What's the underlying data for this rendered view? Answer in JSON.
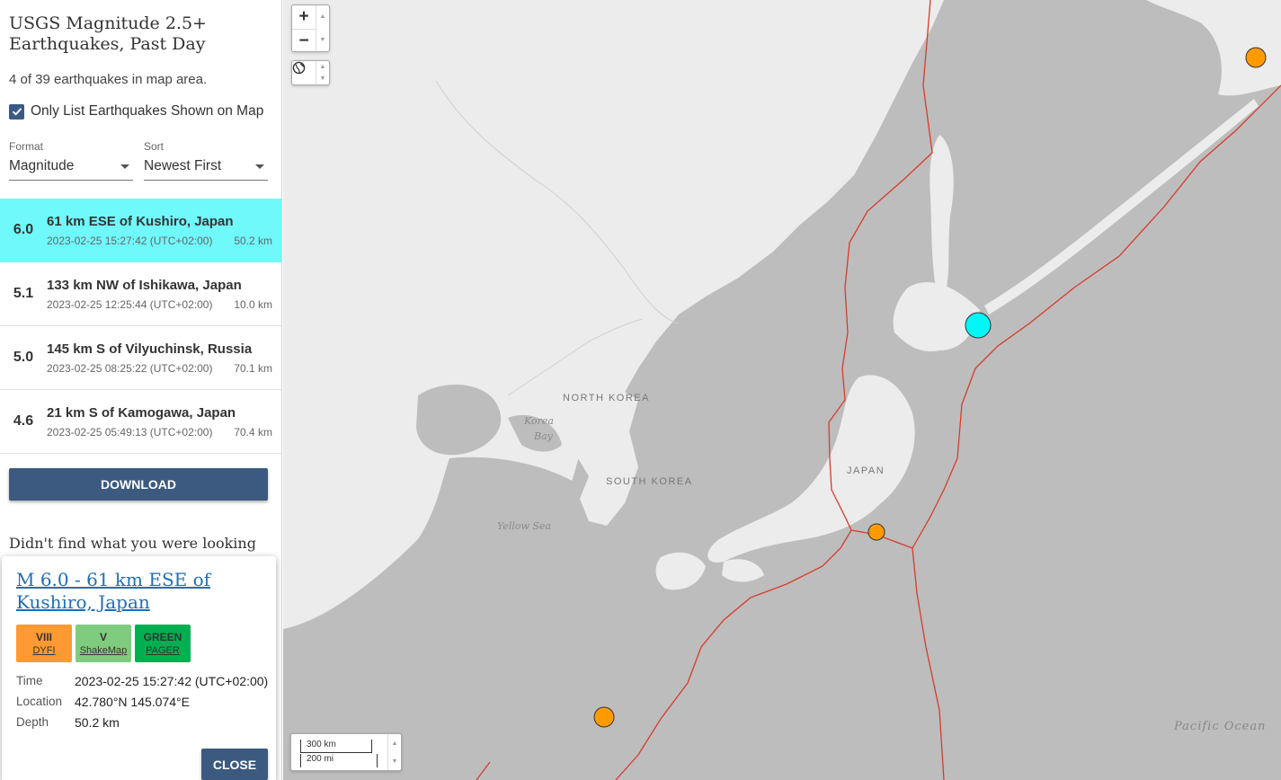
{
  "sidebar": {
    "title": "USGS Magnitude 2.5+ Earthquakes, Past Day",
    "count_text": "4 of 39 earthquakes in map area.",
    "only_list_label": "Only List Earthquakes Shown on Map",
    "only_list_checked": true,
    "format": {
      "label": "Format",
      "value": "Magnitude"
    },
    "sort": {
      "label": "Sort",
      "value": "Newest First"
    },
    "earthquakes": [
      {
        "mag": "6.0",
        "place": "61 km ESE of Kushiro, Japan",
        "time": "2023-02-25 15:27:42 (UTC+02:00)",
        "depth": "50.2 km",
        "selected": true
      },
      {
        "mag": "5.1",
        "place": "133 km NW of Ishikawa, Japan",
        "time": "2023-02-25 12:25:44 (UTC+02:00)",
        "depth": "10.0 km",
        "selected": false
      },
      {
        "mag": "5.0",
        "place": "145 km S of Vilyuchinsk, Russia",
        "time": "2023-02-25 08:25:22 (UTC+02:00)",
        "depth": "70.1 km",
        "selected": false
      },
      {
        "mag": "4.6",
        "place": "21 km S of Kamogawa, Japan",
        "time": "2023-02-25 05:49:13 (UTC+02:00)",
        "depth": "70.4 km",
        "selected": false
      }
    ],
    "download_label": "DOWNLOAD",
    "didnt_find": "Didn't find what you were looking"
  },
  "popup": {
    "title": "M 6.0 - 61 km ESE of Kushiro, Japan",
    "badges": [
      {
        "top": "VIII",
        "bottom": "DYFI",
        "color": "#ff9933"
      },
      {
        "top": "V",
        "bottom": "ShakeMap",
        "color": "#7fcc7f"
      },
      {
        "top": "GREEN",
        "bottom": "PAGER",
        "color": "#00b050"
      }
    ],
    "details": {
      "time_label": "Time",
      "time": "2023-02-25 15:27:42 (UTC+02:00)",
      "location_label": "Location",
      "location": "42.780°N 145.074°E",
      "depth_label": "Depth",
      "depth": "50.2 km"
    },
    "close_label": "CLOSE"
  },
  "map": {
    "zoom_in": "+",
    "zoom_out": "−",
    "layers_icon": "globe-icon",
    "scale_km": "300 km",
    "scale_mi": "200 mi",
    "labels": {
      "north_korea": "NORTH KOREA",
      "south_korea": "SOUTH KOREA",
      "japan": "JAPAN",
      "korea_bay_1": "Korea",
      "korea_bay_2": "Bay",
      "yellow_sea": "Yellow Sea",
      "pacific": "Pacific Ocean"
    },
    "colors": {
      "selected_quake": "#00f7f7",
      "quake": "#ff9b00",
      "plate_boundary": "#d93a2b",
      "land": "#ececec",
      "water": "#bdbdbd"
    }
  }
}
